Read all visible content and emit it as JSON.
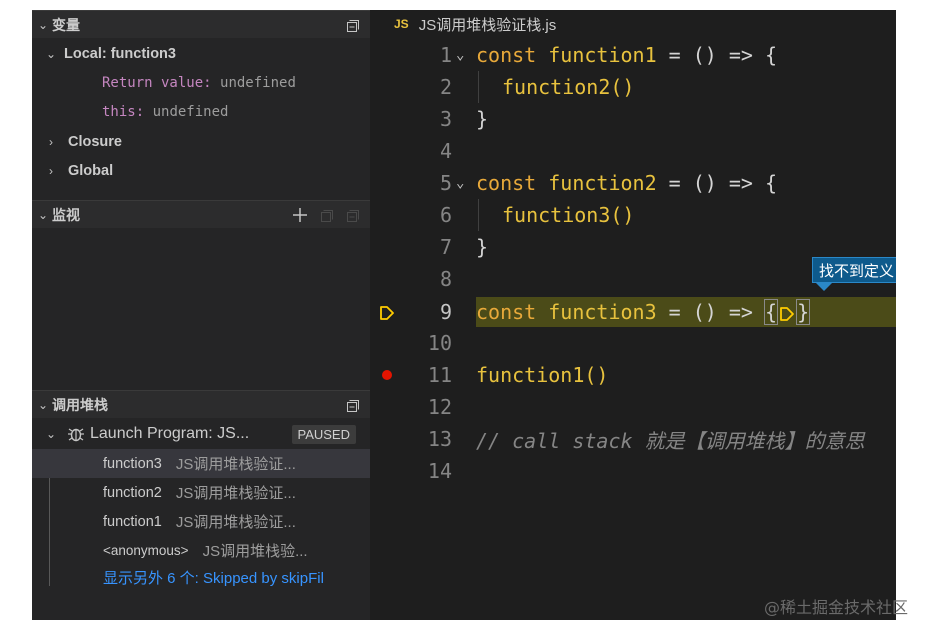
{
  "sidebar": {
    "variables": {
      "header": "变量",
      "local_scope": "Local: function3",
      "items": [
        {
          "key": "Return value:",
          "value": "undefined"
        },
        {
          "key": "this:",
          "value": "undefined"
        }
      ],
      "closure": "Closure",
      "global": "Global"
    },
    "watch": {
      "header": "监视"
    },
    "call_stack": {
      "header": "调用堆栈",
      "session": "Launch Program: JS...",
      "status": "PAUSED",
      "frames": [
        {
          "fn": "function3",
          "file": "JS调用堆栈验证..."
        },
        {
          "fn": "function2",
          "file": "JS调用堆栈验证..."
        },
        {
          "fn": "function1",
          "file": "JS调用堆栈验证..."
        },
        {
          "fn": "<anonymous>",
          "file": "JS调用堆栈验..."
        }
      ],
      "skipped": "显示另外 6 个: Skipped by skipFil"
    }
  },
  "editor": {
    "badge": "JS",
    "filename": "JS调用堆栈验证栈.js",
    "current_line": 9,
    "breakpoint_line": 11,
    "lines": [
      {
        "n": "1",
        "kw": "const",
        "name": "function1",
        "rest": " = () => {"
      },
      {
        "n": "2",
        "call": "function2()"
      },
      {
        "n": "3",
        "text": "}"
      },
      {
        "n": "4"
      },
      {
        "n": "5",
        "kw": "const",
        "name": "function2",
        "rest": " = () => {"
      },
      {
        "n": "6",
        "call": "function3()"
      },
      {
        "n": "7",
        "text": "}"
      },
      {
        "n": "8"
      },
      {
        "n": "9",
        "kw": "const",
        "name": "function3",
        "rest": " = () => "
      },
      {
        "n": "10"
      },
      {
        "n": "11",
        "call": "function1()"
      },
      {
        "n": "12"
      },
      {
        "n": "13",
        "comment": "// call stack 就是【调用堆栈】的意思"
      },
      {
        "n": "14"
      }
    ],
    "hover_tip": "找不到定义"
  },
  "watermark": "@稀土掘金技术社区",
  "colors": {
    "keyword": "#e8a93a",
    "function_name": "#e8c23e",
    "variable_key": "#c586c0",
    "breakpoint": "#e51400",
    "link": "#3794ff",
    "current_line_bg": "#4b4b18"
  }
}
